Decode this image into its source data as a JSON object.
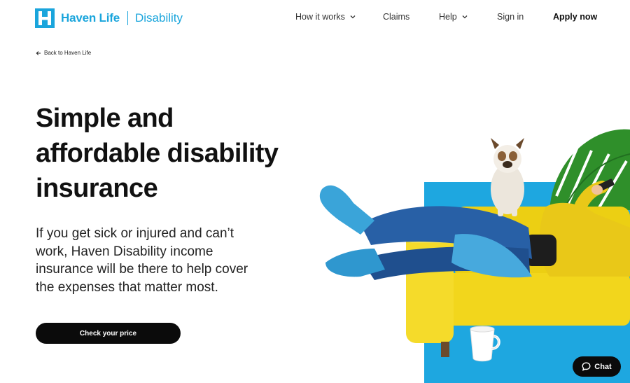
{
  "header": {
    "brand": "Haven Life",
    "product": "Disability",
    "nav": [
      {
        "label": "How it works",
        "has_dropdown": true
      },
      {
        "label": "Claims",
        "has_dropdown": false
      },
      {
        "label": "Help",
        "has_dropdown": true
      },
      {
        "label": "Sign in",
        "has_dropdown": false
      },
      {
        "label": "Apply now",
        "has_dropdown": false
      }
    ]
  },
  "back_link": "Back to Haven Life",
  "hero": {
    "title_lines": [
      "Simple and",
      "affordable disability",
      "insurance"
    ],
    "subtitle": "If you get sick or injured and can’t work, Haven Disability income insurance will be there to help cover the expenses that matter most.",
    "cta": "Check your price"
  },
  "chat": {
    "label": "Chat"
  },
  "colors": {
    "brand_blue": "#1aa5dc",
    "cta_black": "#0b0b0b",
    "sofa_yellow": "#f2d61c",
    "backdrop_blue": "#1ea7e0",
    "leaf_green": "#2f8f2a"
  },
  "icons": {
    "logo": "haven-life-logo-icon",
    "dropdown": "chevron-down-icon",
    "back": "arrow-left-icon",
    "chat": "chat-bubble-icon"
  }
}
